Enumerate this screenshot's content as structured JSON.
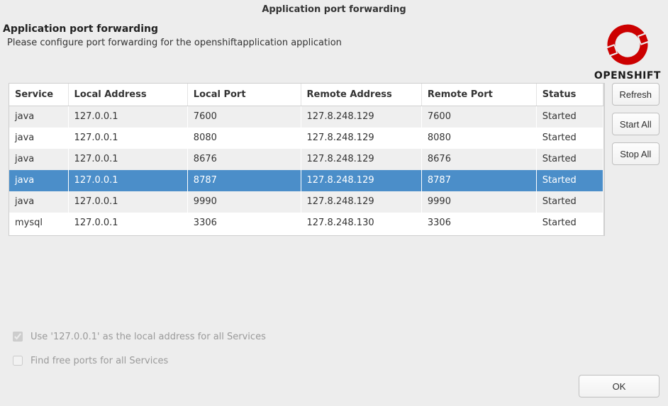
{
  "dialog": {
    "title": "Application port forwarding"
  },
  "header": {
    "heading": "Application port forwarding",
    "description": "Please configure port forwarding for the openshiftapplication application",
    "logo_text": "OPENSHIFT"
  },
  "table": {
    "columns": {
      "service": "Service",
      "local_address": "Local Address",
      "local_port": "Local Port",
      "remote_address": "Remote Address",
      "remote_port": "Remote Port",
      "status": "Status"
    },
    "rows": [
      {
        "service": "java",
        "local_address": "127.0.0.1",
        "local_port": "7600",
        "remote_address": "127.8.248.129",
        "remote_port": "7600",
        "status": "Started",
        "selected": false
      },
      {
        "service": "java",
        "local_address": "127.0.0.1",
        "local_port": "8080",
        "remote_address": "127.8.248.129",
        "remote_port": "8080",
        "status": "Started",
        "selected": false
      },
      {
        "service": "java",
        "local_address": "127.0.0.1",
        "local_port": "8676",
        "remote_address": "127.8.248.129",
        "remote_port": "8676",
        "status": "Started",
        "selected": false
      },
      {
        "service": "java",
        "local_address": "127.0.0.1",
        "local_port": "8787",
        "remote_address": "127.8.248.129",
        "remote_port": "8787",
        "status": "Started",
        "selected": true
      },
      {
        "service": "java",
        "local_address": "127.0.0.1",
        "local_port": "9990",
        "remote_address": "127.8.248.129",
        "remote_port": "9990",
        "status": "Started",
        "selected": false
      },
      {
        "service": "mysql",
        "local_address": "127.0.0.1",
        "local_port": "3306",
        "remote_address": "127.8.248.130",
        "remote_port": "3306",
        "status": "Started",
        "selected": false
      }
    ]
  },
  "buttons": {
    "refresh": "Refresh",
    "start_all": "Start All",
    "stop_all": "Stop All",
    "ok": "OK"
  },
  "checks": {
    "use_local": {
      "label": "Use '127.0.0.1' as the local address for all Services",
      "checked": true,
      "disabled": true
    },
    "find_free": {
      "label": "Find free ports for all Services",
      "checked": false,
      "disabled": true
    }
  }
}
